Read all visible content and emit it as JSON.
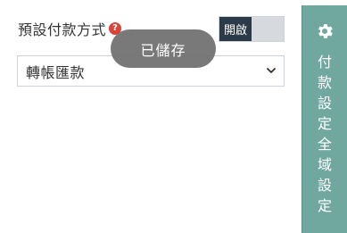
{
  "setting": {
    "label": "預設付款方式",
    "help_icon": "question-icon",
    "toggle_on_label": "開啟"
  },
  "payment_select": {
    "selected_value": "轉帳匯款"
  },
  "toast": {
    "message": "已儲存"
  },
  "side_panel": {
    "icon": "gear-icon",
    "chars": [
      "付",
      "款",
      "設",
      "定",
      "全",
      "域",
      "設",
      "定"
    ]
  },
  "colors": {
    "toggle_on_bg": "#2b3a48",
    "toggle_off_bg": "#d6dade",
    "side_panel_bg": "#70a8a0",
    "help_icon_bg": "#d9433a",
    "toast_bg": "#6e6e6e"
  }
}
